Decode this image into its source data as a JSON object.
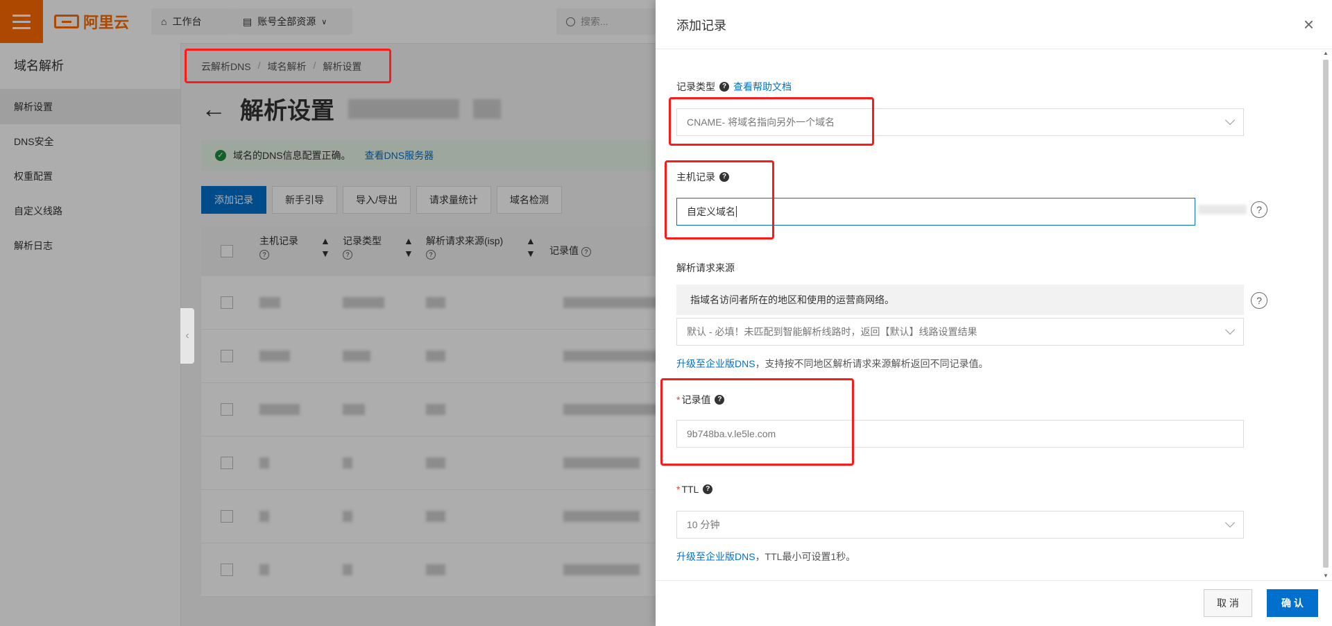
{
  "header": {
    "brand": "阿里云",
    "workbench_label": "工作台",
    "resources_label": "账号全部资源",
    "search_placeholder": "搜索..."
  },
  "sidebar": {
    "title": "域名解析",
    "items": [
      {
        "label": "解析设置",
        "active": true
      },
      {
        "label": "DNS安全"
      },
      {
        "label": "权重配置"
      },
      {
        "label": "自定义线路"
      },
      {
        "label": "解析日志"
      }
    ]
  },
  "breadcrumb": [
    "云解析DNS",
    "域名解析",
    "解析设置"
  ],
  "page": {
    "title": "解析设置",
    "alert_text": "域名的DNS信息配置正确。",
    "alert_link": "查看DNS服务器"
  },
  "toolbar": {
    "buttons": [
      "添加记录",
      "新手引导",
      "导入/导出",
      "请求量统计",
      "域名检测"
    ]
  },
  "table": {
    "headers": [
      "主机记录",
      "记录类型",
      "解析请求来源(isp)",
      "记录值"
    ]
  },
  "drawer": {
    "title": "添加记录",
    "record_type": {
      "label": "记录类型",
      "help_link": "查看帮助文档",
      "value": "CNAME- 将域名指向另外一个域名"
    },
    "host": {
      "label": "主机记录",
      "value": "自定义域名"
    },
    "source": {
      "label": "解析请求来源",
      "hint": "指域名访问者所在的地区和使用的运营商网络。",
      "value": "默认 - 必填！未匹配到智能解析线路时，返回【默认】线路设置结果",
      "upgrade_link": "升级至企业版DNS",
      "upgrade_note": "，支持按不同地区解析请求来源解析返回不同记录值。"
    },
    "record_value": {
      "label": "记录值",
      "value": "9b748ba.v.le5le.com"
    },
    "ttl": {
      "label": "TTL",
      "value": "10 分钟",
      "upgrade_link": "升级至企业版DNS",
      "upgrade_note": "，TTL最小可设置1秒。"
    },
    "cancel_label": "取 消",
    "confirm_label": "确 认"
  },
  "colors": {
    "brand_orange": "#ff6a00",
    "primary_blue": "#0070cc",
    "annotation_red": "#ff1a1a"
  }
}
